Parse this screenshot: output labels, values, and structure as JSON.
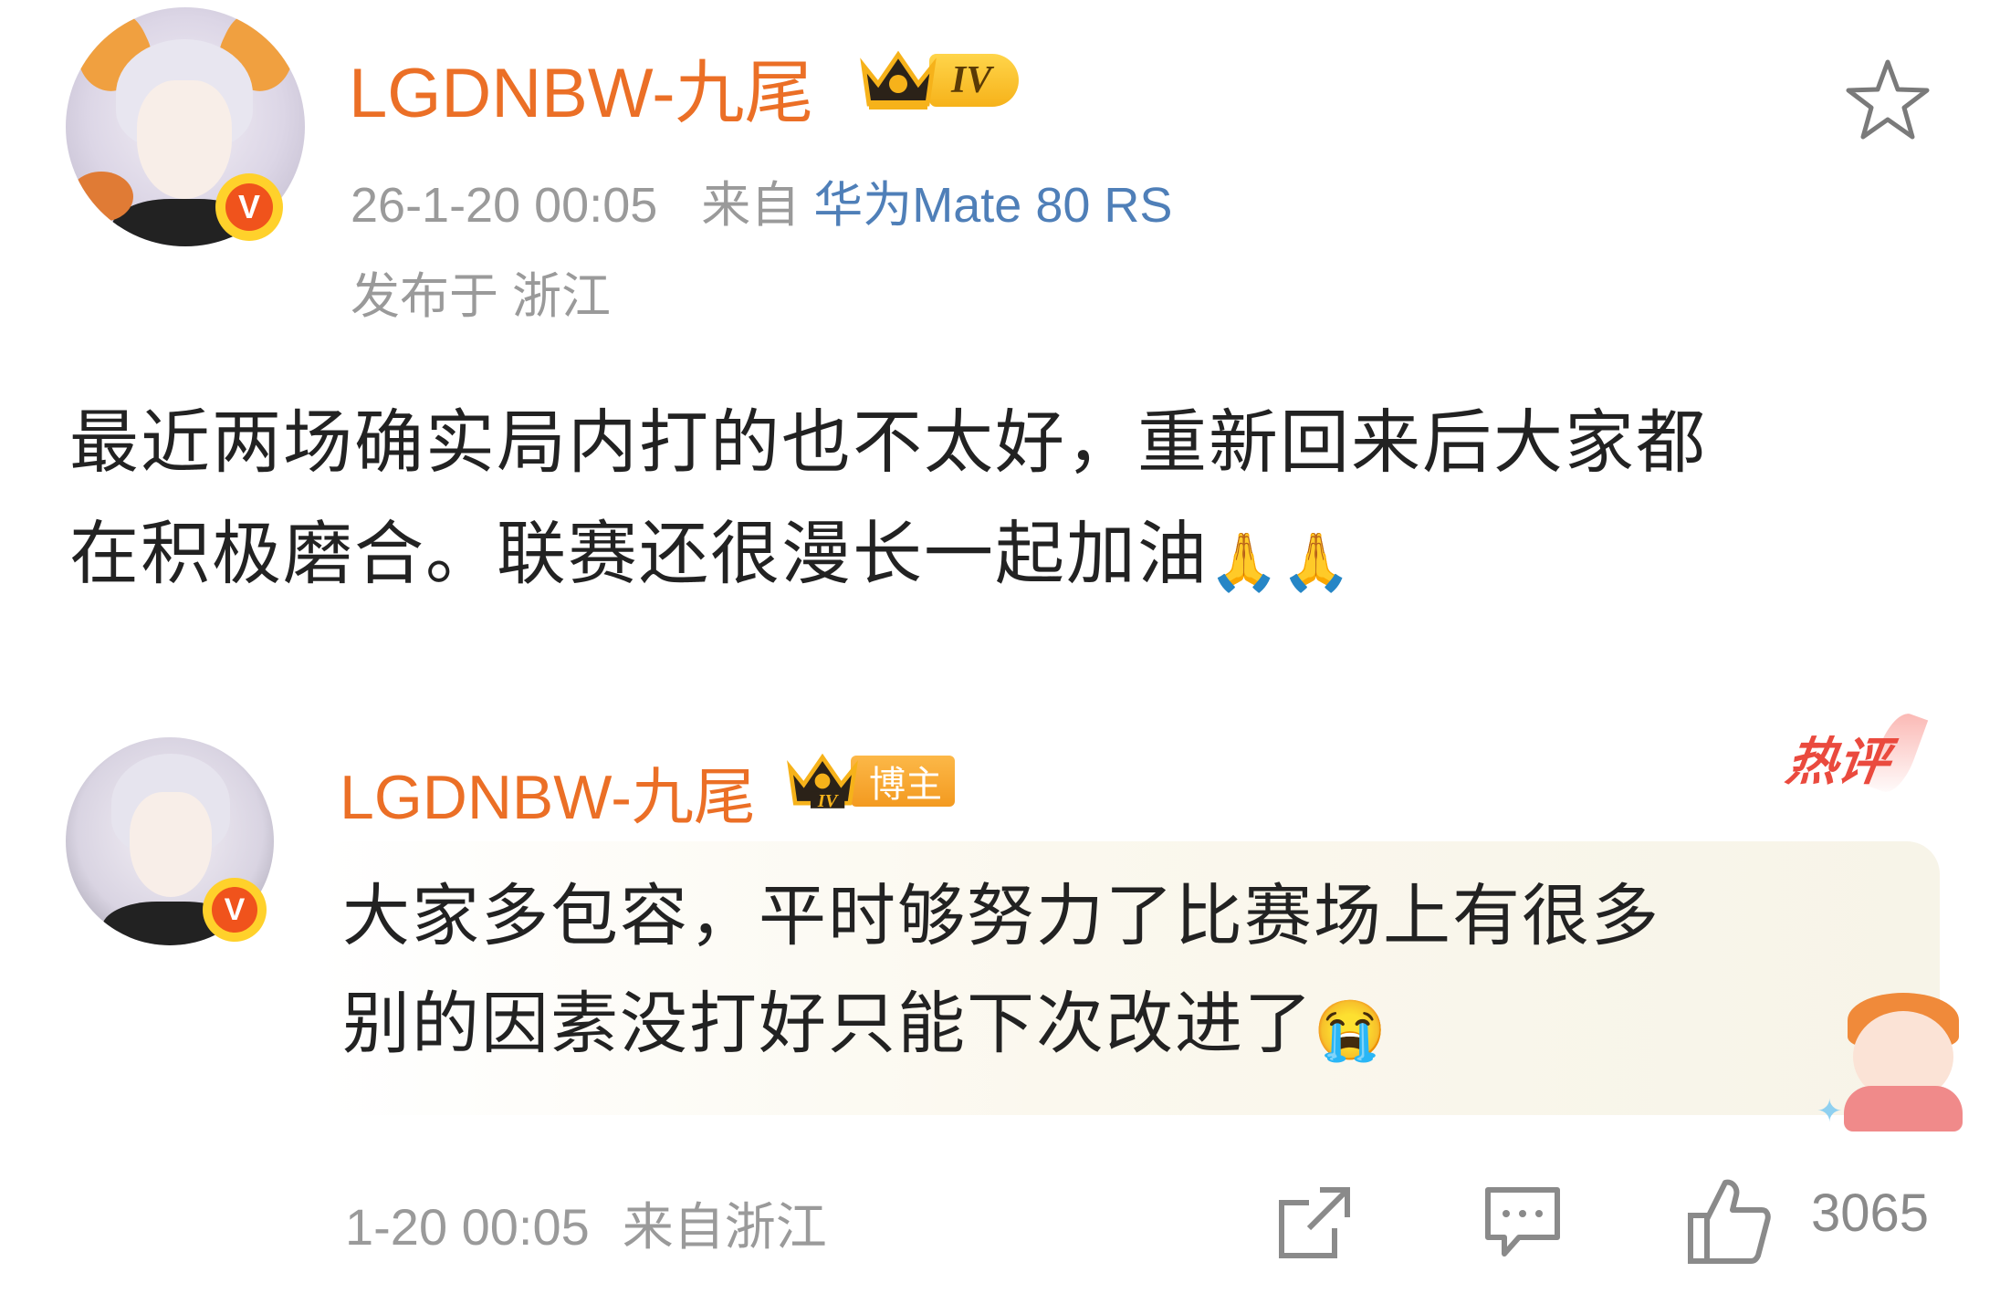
{
  "post": {
    "author": "LGDNBW-九尾",
    "level_badge": "IV",
    "verified_badge": "V",
    "timestamp": "26-1-20 00:05",
    "source_prefix": "来自",
    "device": "华为Mate 80 RS",
    "location": "发布于 浙江",
    "text_line1": "最近两场确实局内打的也不太好，重新回来后大家都",
    "text_line2": "在积极磨合。联赛还很漫长一起加油",
    "emojis": [
      "🙏",
      "🙏"
    ]
  },
  "comment": {
    "author": "LGDNBW-九尾",
    "crown_level": "IV",
    "role_badge": "博主",
    "verified_badge": "V",
    "hot_tag": "热评",
    "text_line1": "大家多包容，平时够努力了比赛场上有很多",
    "text_line2": "别的因素没打好只能下次改进了",
    "emoji": "😭",
    "timestamp": "1-20 00:05",
    "source": "来自浙江",
    "like_count": "3065"
  },
  "colors": {
    "username": "#eb6f26",
    "meta": "#9a9a9a",
    "device_link": "#4f7fb8",
    "hot": "#ea4a3e",
    "badge_gold": "#f6b21a",
    "verified": "#f0531c"
  },
  "icons": [
    "star-icon",
    "crown-icon",
    "share-icon",
    "comment-icon",
    "thumbs-up-icon"
  ]
}
